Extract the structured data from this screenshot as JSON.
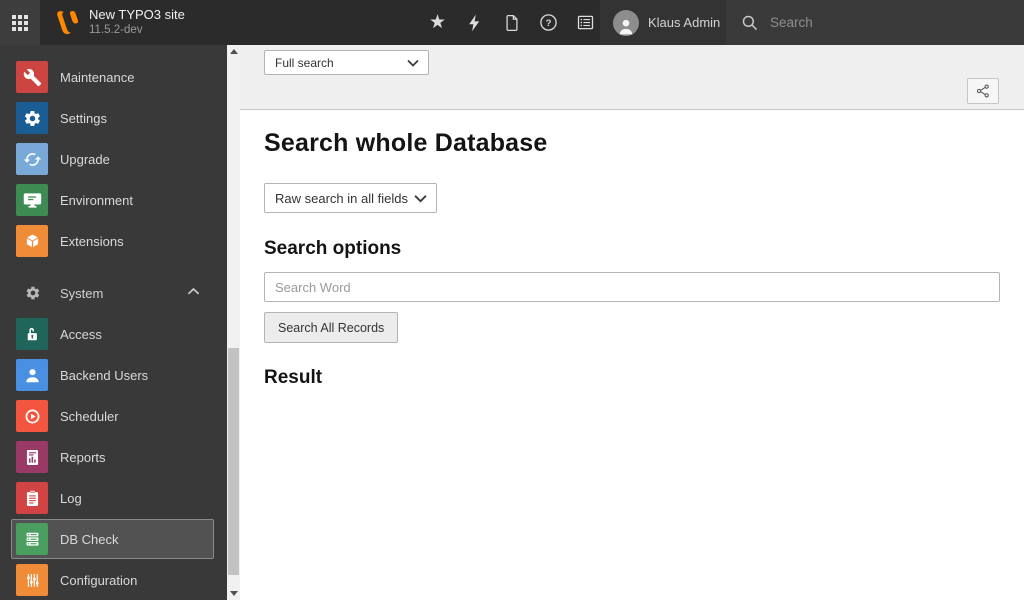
{
  "topbar": {
    "site_title": "New TYPO3 site",
    "site_version": "11.5.2-dev",
    "user_name": "Klaus Admin",
    "search_placeholder": "Search",
    "brand_color": "#ff8700"
  },
  "sidebar": {
    "section_label": "System",
    "items": [
      {
        "label": "Maintenance",
        "color": "#cc4540"
      },
      {
        "label": "Settings",
        "color": "#1a5c94"
      },
      {
        "label": "Upgrade",
        "color": "#79a9d8"
      },
      {
        "label": "Environment",
        "color": "#3d8b52"
      },
      {
        "label": "Extensions",
        "color": "#f08b38"
      },
      {
        "label": "Access",
        "color": "#20655a"
      },
      {
        "label": "Backend Users",
        "color": "#4a90e2"
      },
      {
        "label": "Scheduler",
        "color": "#f4553f"
      },
      {
        "label": "Reports",
        "color": "#993a66"
      },
      {
        "label": "Log",
        "color": "#d24444"
      },
      {
        "label": "DB Check",
        "color": "#4a9e5f",
        "selected": true
      },
      {
        "label": "Configuration",
        "color": "#f08b38"
      }
    ]
  },
  "docheader": {
    "module_select_value": "Full search"
  },
  "content": {
    "page_title": "Search whole Database",
    "mode_select_value": "Raw search in all fields",
    "options_heading": "Search options",
    "search_input_placeholder": "Search Word",
    "search_button_label": "Search All Records",
    "result_heading": "Result"
  }
}
